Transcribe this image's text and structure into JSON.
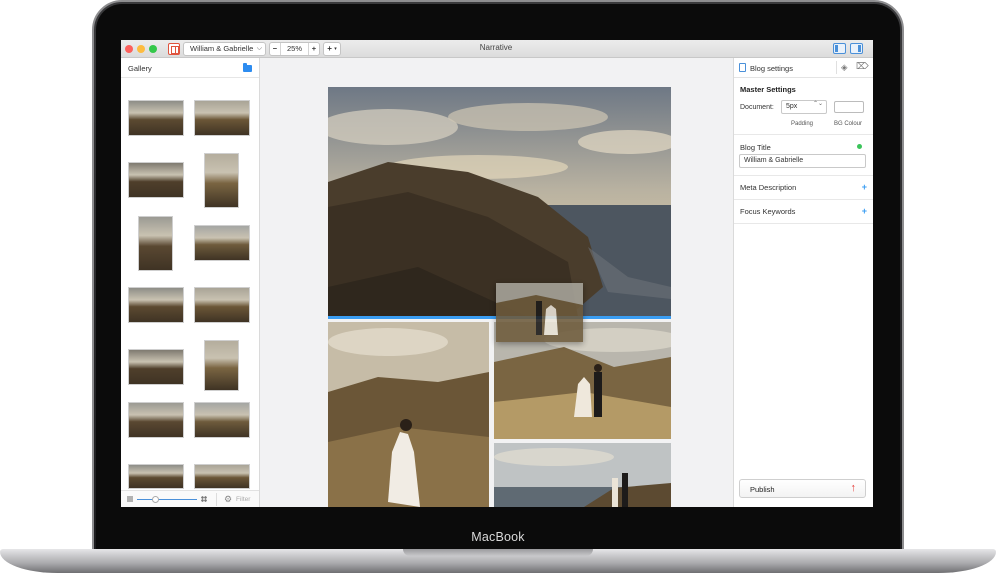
{
  "device": {
    "brand": "MacBook"
  },
  "window": {
    "title": "Narrative",
    "document_name": "William & Gabrielle",
    "zoom": "25%",
    "zoom_minus": "−",
    "zoom_plus": "+",
    "add_label": "+",
    "add_caret": "▾",
    "doc_caret": "⌵"
  },
  "gallery": {
    "title": "Gallery",
    "filter_label": "Filter",
    "thumb_size_fraction": 0.3
  },
  "settings": {
    "tab_label": "Blog settings",
    "master_title": "Master Settings",
    "document_label": "Document:",
    "padding_value": "5px",
    "stepper": "⌃⌄",
    "padding_caption": "Padding",
    "bg_caption": "BG Colour",
    "bg_colour": "#ffffff",
    "blog_title_label": "Blog Title",
    "blog_title_value": "William & Gabrielle",
    "meta_label": "Meta Description",
    "focus_label": "Focus Keywords",
    "plus": "+",
    "publish_label": "Publish",
    "publish_icon": "↑"
  },
  "colors": {
    "accent_blue": "#3a9df2",
    "status_green": "#3bc45a",
    "publish_red": "#e53935"
  },
  "icons": {
    "gear": "⚙",
    "gem": "◈",
    "tag": "⌦"
  }
}
